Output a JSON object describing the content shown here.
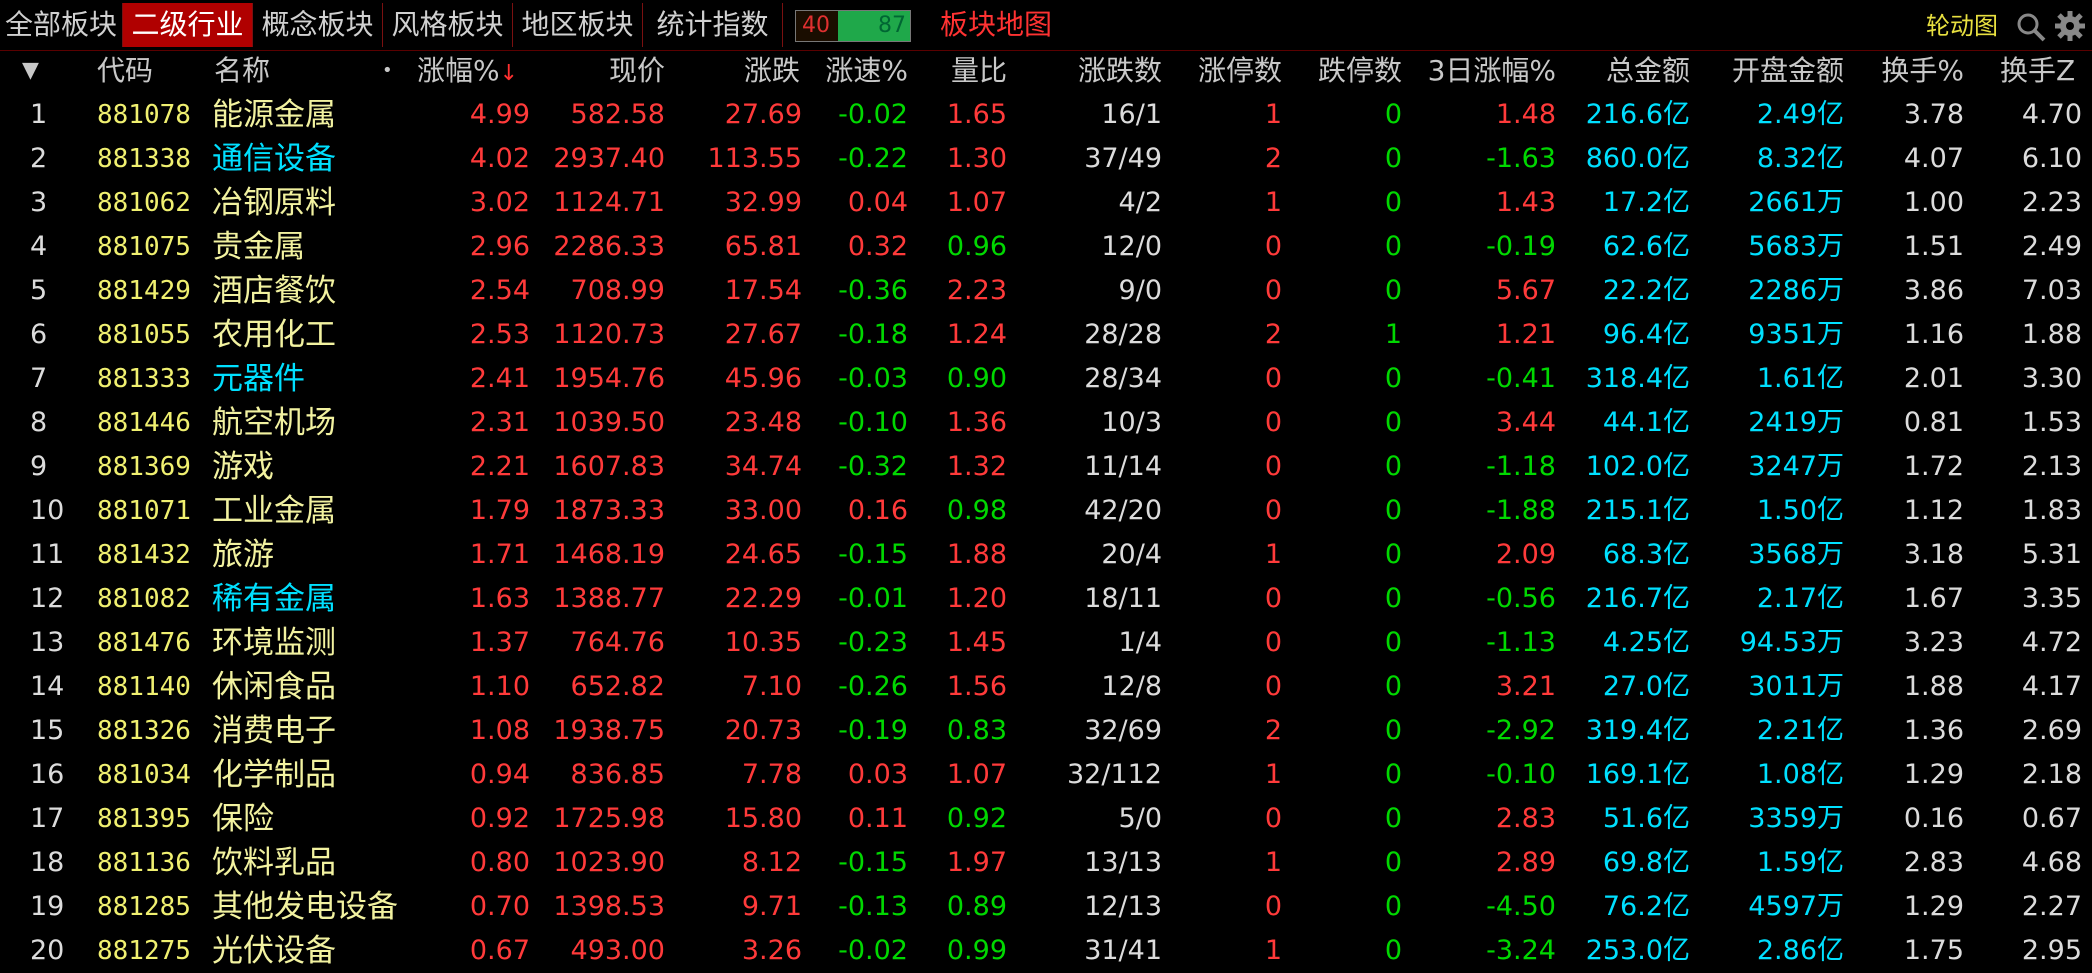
{
  "tabs": [
    {
      "label": "全部板块",
      "active": false
    },
    {
      "label": "二级行业",
      "active": true
    },
    {
      "label": "概念板块",
      "active": false
    },
    {
      "label": "风格板块",
      "active": false
    },
    {
      "label": "地区板块",
      "active": false
    },
    {
      "label": "统计指数",
      "active": false
    }
  ],
  "counter": {
    "up": "40",
    "down": "87"
  },
  "map_link": "板块地图",
  "rotate_link": "轮动图",
  "columns": {
    "sort_arrow": "▼",
    "code": "代码",
    "name": "名称",
    "dot": "•",
    "change_pct": "涨幅%",
    "sort_indicator": "↓",
    "price": "现价",
    "change": "涨跌",
    "speed": "涨速%",
    "vol_ratio": "量比",
    "up_down": "涨跌数",
    "limit_up": "涨停数",
    "limit_down": "跌停数",
    "three_day": "3日涨幅%",
    "amount": "总金额",
    "open_amount": "开盘金额",
    "turnover": "换手%",
    "turnover_z": "换手Z"
  },
  "colors": {
    "red": "#ff3a3a",
    "green": "#00d800",
    "cyan": "#00e0ff",
    "yellow": "#f2f2a0",
    "white": "#dcdcdc",
    "active_tab": "#b00000"
  },
  "rows": [
    {
      "idx": "1",
      "code": "881078",
      "name": "能源金属",
      "name_color": "yellow",
      "chg_pct": "4.99",
      "price": "582.58",
      "chg": "27.69",
      "speed": "-0.02",
      "vr": "1.65",
      "vr_color": "red",
      "ud": "16/1",
      "lu": "1",
      "lu_color": "red",
      "ld": "0",
      "three": "1.48",
      "three_color": "red",
      "amt": "216.6亿",
      "open": "2.49亿",
      "to": "3.78",
      "toz": "4.70"
    },
    {
      "idx": "2",
      "code": "881338",
      "name": "通信设备",
      "name_color": "cyan",
      "chg_pct": "4.02",
      "price": "2937.40",
      "chg": "113.55",
      "speed": "-0.22",
      "vr": "1.30",
      "vr_color": "red",
      "ud": "37/49",
      "lu": "2",
      "lu_color": "red",
      "ld": "0",
      "three": "-1.63",
      "three_color": "green",
      "amt": "860.0亿",
      "open": "8.32亿",
      "to": "4.07",
      "toz": "6.10"
    },
    {
      "idx": "3",
      "code": "881062",
      "name": "冶钢原料",
      "name_color": "yellow",
      "chg_pct": "3.02",
      "price": "1124.71",
      "chg": "32.99",
      "speed": "0.04",
      "vr": "1.07",
      "vr_color": "red",
      "ud": "4/2",
      "lu": "1",
      "lu_color": "red",
      "ld": "0",
      "three": "1.43",
      "three_color": "red",
      "amt": "17.2亿",
      "open": "2661万",
      "to": "1.00",
      "toz": "2.23"
    },
    {
      "idx": "4",
      "code": "881075",
      "name": "贵金属",
      "name_color": "yellow",
      "chg_pct": "2.96",
      "price": "2286.33",
      "chg": "65.81",
      "speed": "0.32",
      "vr": "0.96",
      "vr_color": "green",
      "ud": "12/0",
      "lu": "0",
      "lu_color": "red",
      "ld": "0",
      "three": "-0.19",
      "three_color": "green",
      "amt": "62.6亿",
      "open": "5683万",
      "to": "1.51",
      "toz": "2.49"
    },
    {
      "idx": "5",
      "code": "881429",
      "name": "酒店餐饮",
      "name_color": "yellow",
      "chg_pct": "2.54",
      "price": "708.99",
      "chg": "17.54",
      "speed": "-0.36",
      "vr": "2.23",
      "vr_color": "red",
      "ud": "9/0",
      "lu": "0",
      "lu_color": "red",
      "ld": "0",
      "three": "5.67",
      "three_color": "red",
      "amt": "22.2亿",
      "open": "2286万",
      "to": "3.86",
      "toz": "7.03"
    },
    {
      "idx": "6",
      "code": "881055",
      "name": "农用化工",
      "name_color": "yellow",
      "chg_pct": "2.53",
      "price": "1120.73",
      "chg": "27.67",
      "speed": "-0.18",
      "vr": "1.24",
      "vr_color": "red",
      "ud": "28/28",
      "lu": "2",
      "lu_color": "red",
      "ld": "1",
      "three": "1.21",
      "three_color": "red",
      "amt": "96.4亿",
      "open": "9351万",
      "to": "1.16",
      "toz": "1.88"
    },
    {
      "idx": "7",
      "code": "881333",
      "name": "元器件",
      "name_color": "cyan",
      "chg_pct": "2.41",
      "price": "1954.76",
      "chg": "45.96",
      "speed": "-0.03",
      "vr": "0.90",
      "vr_color": "green",
      "ud": "28/34",
      "lu": "0",
      "lu_color": "red",
      "ld": "0",
      "three": "-0.41",
      "three_color": "green",
      "amt": "318.4亿",
      "open": "1.61亿",
      "to": "2.01",
      "toz": "3.30"
    },
    {
      "idx": "8",
      "code": "881446",
      "name": "航空机场",
      "name_color": "yellow",
      "chg_pct": "2.31",
      "price": "1039.50",
      "chg": "23.48",
      "speed": "-0.10",
      "vr": "1.36",
      "vr_color": "red",
      "ud": "10/3",
      "lu": "0",
      "lu_color": "red",
      "ld": "0",
      "three": "3.44",
      "three_color": "red",
      "amt": "44.1亿",
      "open": "2419万",
      "to": "0.81",
      "toz": "1.53"
    },
    {
      "idx": "9",
      "code": "881369",
      "name": "游戏",
      "name_color": "yellow",
      "chg_pct": "2.21",
      "price": "1607.83",
      "chg": "34.74",
      "speed": "-0.32",
      "vr": "1.32",
      "vr_color": "red",
      "ud": "11/14",
      "lu": "0",
      "lu_color": "red",
      "ld": "0",
      "three": "-1.18",
      "three_color": "green",
      "amt": "102.0亿",
      "open": "3247万",
      "to": "1.72",
      "toz": "2.13"
    },
    {
      "idx": "10",
      "code": "881071",
      "name": "工业金属",
      "name_color": "yellow",
      "chg_pct": "1.79",
      "price": "1873.33",
      "chg": "33.00",
      "speed": "0.16",
      "vr": "0.98",
      "vr_color": "green",
      "ud": "42/20",
      "lu": "0",
      "lu_color": "red",
      "ld": "0",
      "three": "-1.88",
      "three_color": "green",
      "amt": "215.1亿",
      "open": "1.50亿",
      "to": "1.12",
      "toz": "1.83"
    },
    {
      "idx": "11",
      "code": "881432",
      "name": "旅游",
      "name_color": "yellow",
      "chg_pct": "1.71",
      "price": "1468.19",
      "chg": "24.65",
      "speed": "-0.15",
      "vr": "1.88",
      "vr_color": "red",
      "ud": "20/4",
      "lu": "1",
      "lu_color": "red",
      "ld": "0",
      "three": "2.09",
      "three_color": "red",
      "amt": "68.3亿",
      "open": "3568万",
      "to": "3.18",
      "toz": "5.31"
    },
    {
      "idx": "12",
      "code": "881082",
      "name": "稀有金属",
      "name_color": "cyan",
      "chg_pct": "1.63",
      "price": "1388.77",
      "chg": "22.29",
      "speed": "-0.01",
      "vr": "1.20",
      "vr_color": "red",
      "ud": "18/11",
      "lu": "0",
      "lu_color": "red",
      "ld": "0",
      "three": "-0.56",
      "three_color": "green",
      "amt": "216.7亿",
      "open": "2.17亿",
      "to": "1.67",
      "toz": "3.35"
    },
    {
      "idx": "13",
      "code": "881476",
      "name": "环境监测",
      "name_color": "yellow",
      "chg_pct": "1.37",
      "price": "764.76",
      "chg": "10.35",
      "speed": "-0.23",
      "vr": "1.45",
      "vr_color": "red",
      "ud": "1/4",
      "lu": "0",
      "lu_color": "red",
      "ld": "0",
      "three": "-1.13",
      "three_color": "green",
      "amt": "4.25亿",
      "open": "94.53万",
      "to": "3.23",
      "toz": "4.72"
    },
    {
      "idx": "14",
      "code": "881140",
      "name": "休闲食品",
      "name_color": "yellow",
      "chg_pct": "1.10",
      "price": "652.82",
      "chg": "7.10",
      "speed": "-0.26",
      "vr": "1.56",
      "vr_color": "red",
      "ud": "12/8",
      "lu": "0",
      "lu_color": "red",
      "ld": "0",
      "three": "3.21",
      "three_color": "red",
      "amt": "27.0亿",
      "open": "3011万",
      "to": "1.88",
      "toz": "4.17"
    },
    {
      "idx": "15",
      "code": "881326",
      "name": "消费电子",
      "name_color": "yellow",
      "chg_pct": "1.08",
      "price": "1938.75",
      "chg": "20.73",
      "speed": "-0.19",
      "vr": "0.83",
      "vr_color": "green",
      "ud": "32/69",
      "lu": "2",
      "lu_color": "red",
      "ld": "0",
      "three": "-2.92",
      "three_color": "green",
      "amt": "319.4亿",
      "open": "2.21亿",
      "to": "1.36",
      "toz": "2.69"
    },
    {
      "idx": "16",
      "code": "881034",
      "name": "化学制品",
      "name_color": "yellow",
      "chg_pct": "0.94",
      "price": "836.85",
      "chg": "7.78",
      "speed": "0.03",
      "vr": "1.07",
      "vr_color": "red",
      "ud": "32/112",
      "lu": "1",
      "lu_color": "red",
      "ld": "0",
      "three": "-0.10",
      "three_color": "green",
      "amt": "169.1亿",
      "open": "1.08亿",
      "to": "1.29",
      "toz": "2.18"
    },
    {
      "idx": "17",
      "code": "881395",
      "name": "保险",
      "name_color": "yellow",
      "chg_pct": "0.92",
      "price": "1725.98",
      "chg": "15.80",
      "speed": "0.11",
      "vr": "0.92",
      "vr_color": "green",
      "ud": "5/0",
      "lu": "0",
      "lu_color": "red",
      "ld": "0",
      "three": "2.83",
      "three_color": "red",
      "amt": "51.6亿",
      "open": "3359万",
      "to": "0.16",
      "toz": "0.67"
    },
    {
      "idx": "18",
      "code": "881136",
      "name": "饮料乳品",
      "name_color": "yellow",
      "chg_pct": "0.80",
      "price": "1023.90",
      "chg": "8.12",
      "speed": "-0.15",
      "vr": "1.97",
      "vr_color": "red",
      "ud": "13/13",
      "lu": "1",
      "lu_color": "red",
      "ld": "0",
      "three": "2.89",
      "three_color": "red",
      "amt": "69.8亿",
      "open": "1.59亿",
      "to": "2.83",
      "toz": "4.68"
    },
    {
      "idx": "19",
      "code": "881285",
      "name": "其他发电设备",
      "name_color": "yellow",
      "chg_pct": "0.70",
      "price": "1398.53",
      "chg": "9.71",
      "speed": "-0.13",
      "vr": "0.89",
      "vr_color": "green",
      "ud": "12/13",
      "lu": "0",
      "lu_color": "red",
      "ld": "0",
      "three": "-4.50",
      "three_color": "green",
      "amt": "76.2亿",
      "open": "4597万",
      "to": "1.29",
      "toz": "2.27"
    },
    {
      "idx": "20",
      "code": "881275",
      "name": "光伏设备",
      "name_color": "yellow",
      "chg_pct": "0.67",
      "price": "493.00",
      "chg": "3.26",
      "speed": "-0.02",
      "vr": "0.99",
      "vr_color": "green",
      "ud": "31/41",
      "lu": "1",
      "lu_color": "red",
      "ld": "0",
      "three": "-3.24",
      "three_color": "green",
      "amt": "253.0亿",
      "open": "2.86亿",
      "to": "1.75",
      "toz": "2.95"
    }
  ]
}
